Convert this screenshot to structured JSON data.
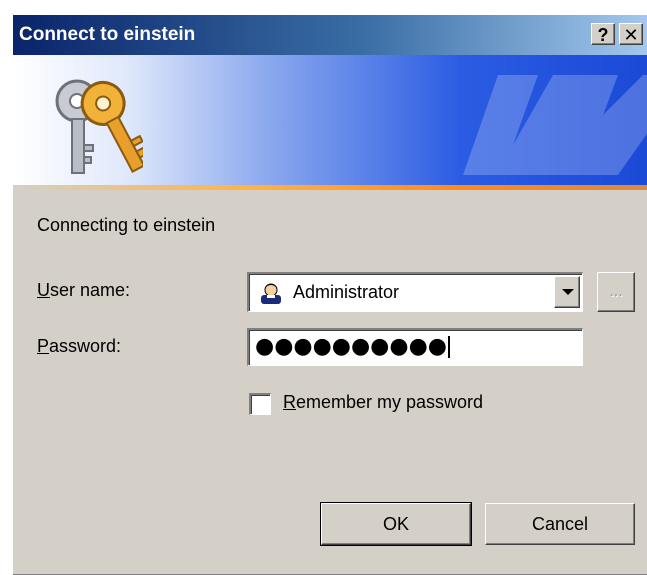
{
  "window": {
    "title": "Connect to einstein",
    "help_button": "?",
    "close_button": "✕"
  },
  "banner": {
    "icon": "keys-icon",
    "watermark_icon": "server-logo-watermark"
  },
  "form": {
    "connecting_text": "Connecting to einstein",
    "user_label_mnemonic": "U",
    "user_label_rest": "ser name:",
    "user_value": "Administrator",
    "user_icon": "user-account-icon",
    "browse_label": "...",
    "password_label_mnemonic": "P",
    "password_label_rest": "assword:",
    "password_masked": "●●●●●●●●●●",
    "remember_checked": false,
    "remember_label_mnemonic": "R",
    "remember_label_rest": "emember my password"
  },
  "buttons": {
    "ok": "OK",
    "cancel": "Cancel"
  },
  "colors": {
    "title_bar_start": "#0a246a",
    "dialog_face": "#d4d0c8",
    "banner_accent": "#ff8a1a"
  }
}
